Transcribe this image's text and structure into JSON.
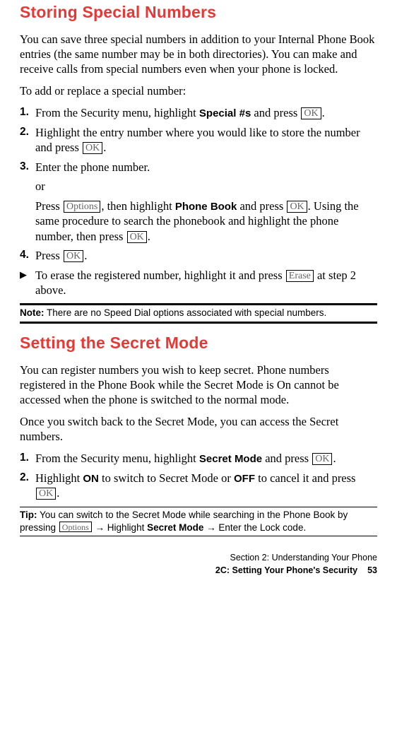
{
  "section1": {
    "heading": "Storing Special Numbers",
    "intro1": "You can save three special numbers in addition to your Internal Phone Book entries (the same number may be in both directories). You can make and receive calls from special numbers even when your phone is locked.",
    "intro2": "To add or replace a special number:",
    "steps": {
      "s1": {
        "num": "1.",
        "pre": "From the Security menu, highlight ",
        "bold": "Special #s",
        "mid": " and press ",
        "key": "OK",
        "post": "."
      },
      "s2": {
        "num": "2.",
        "pre": "Highlight the entry number where you would like to store the number and press ",
        "key": "OK",
        "post": "."
      },
      "s3": {
        "num": "3.",
        "text": "Enter the phone number.",
        "or": "or",
        "alt_pre": "Press ",
        "alt_key1": "Options",
        "alt_mid1": ", then highlight ",
        "alt_bold": "Phone Book",
        "alt_mid2": " and press ",
        "alt_key2": "OK",
        "alt_post": ". Using the same procedure to search the phonebook and highlight the phone number, then press ",
        "alt_key3": "OK",
        "alt_end": "."
      },
      "s4": {
        "num": "4.",
        "pre": "Press ",
        "key": "OK",
        "post": "."
      }
    },
    "bullet": {
      "mark": "▶",
      "pre": "To erase the registered number, highlight it and press ",
      "key": "Erase",
      "post": " at step 2 above."
    },
    "note": {
      "label": "Note:",
      "text": " There are no Speed Dial options associated with special numbers."
    }
  },
  "section2": {
    "heading": "Setting the Secret Mode",
    "intro1": "You can register numbers you wish to keep secret. Phone numbers registered in the Phone Book while the Secret Mode is On cannot be accessed when the phone is switched to the normal mode.",
    "intro2": "Once you switch back to the Secret Mode, you can access the Secret numbers.",
    "steps": {
      "s1": {
        "num": "1.",
        "pre": "From the Security menu, highlight ",
        "bold": "Secret Mode",
        "mid": " and press ",
        "key": "OK",
        "post": "."
      },
      "s2": {
        "num": "2.",
        "pre": "Highlight ",
        "bold1": "ON",
        "mid1": " to switch to Secret Mode or ",
        "bold2": "OFF",
        "mid2": " to cancel it and press ",
        "key": "OK",
        "post": "."
      }
    },
    "tip": {
      "label": "Tip:",
      "pre": " You can switch to the Secret Mode while searching in the Phone Book by pressing ",
      "key": "Options",
      "mid": " → Highlight ",
      "bold": "Secret Mode",
      "post": " → Enter the Lock code."
    }
  },
  "footer": {
    "line1": "Section 2: Understanding Your Phone",
    "line2": "2C: Setting Your Phone's Security",
    "pagenum": "53"
  }
}
